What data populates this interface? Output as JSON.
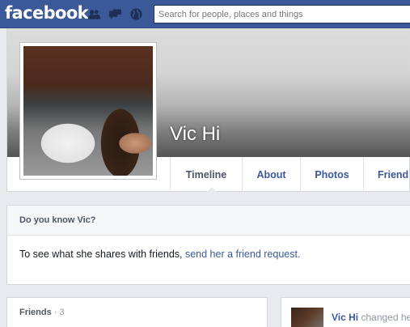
{
  "topbar": {
    "logo": "facebook",
    "search_placeholder": "Search for people, places and things"
  },
  "profile": {
    "name": "Vic Hi"
  },
  "tabs": [
    {
      "label": "Timeline",
      "active": true
    },
    {
      "label": "About",
      "active": false
    },
    {
      "label": "Photos",
      "active": false
    },
    {
      "label": "Friend",
      "active": false
    }
  ],
  "know": {
    "title": "Do you know Vic?",
    "text": "To see what she shares with friends, ",
    "link": "send her a friend request."
  },
  "friends": {
    "title": "Friends",
    "count": " · 3"
  },
  "activity": {
    "actor": "Vic Hi",
    "verb": " changed he"
  },
  "colors": {
    "brand": "#3b5998",
    "page_bg": "#e9eaed"
  },
  "icons": [
    "friend-requests-icon",
    "messages-icon",
    "notifications-globe-icon"
  ]
}
